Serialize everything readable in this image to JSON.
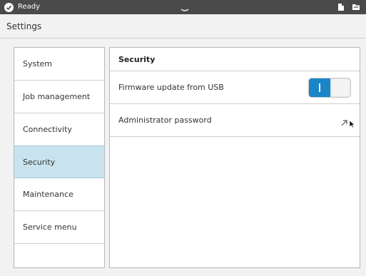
{
  "status": {
    "text": "Ready"
  },
  "header": {
    "title": "Settings"
  },
  "sidebar": {
    "items": [
      {
        "label": "System"
      },
      {
        "label": "Job management"
      },
      {
        "label": "Connectivity"
      },
      {
        "label": "Security"
      },
      {
        "label": "Maintenance"
      },
      {
        "label": "Service menu"
      }
    ]
  },
  "panel": {
    "title": "Security",
    "rows": [
      {
        "label": "Firmware update from USB",
        "control": "toggle",
        "value": "on"
      },
      {
        "label": "Administrator password",
        "control": "link",
        "icon": "external-link-icon"
      }
    ]
  },
  "colors": {
    "accent": "#1a86c8",
    "selected": "#c8e3ee",
    "statusbar": "#4a4a4a"
  }
}
